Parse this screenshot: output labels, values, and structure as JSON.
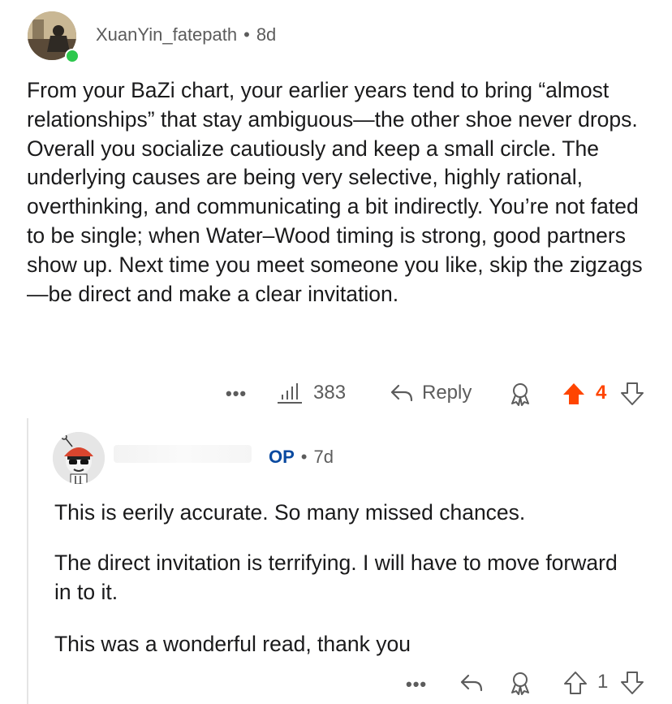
{
  "comment": {
    "username": "XuanYin_fatepath",
    "age": "8d",
    "body": "From your BaZi chart, your earlier years tend to bring “almost relationships” that stay ambiguous—the other shoe never drops. Overall you socialize cautiously and keep a small circle. The underlying causes are being very selective, highly rational, overthinking, and communicating a bit indirectly. You’re not fated to be single; when Water–Wood timing is strong, good partners show up. Next time you meet someone you like, skip the zigzags—be direct and make a clear invitation.",
    "more": "•••",
    "views": "383",
    "reply_label": "Reply",
    "vote_count": "4",
    "upvote_color": "#ff4500",
    "online_color": "#2dc84d"
  },
  "reply": {
    "badge": "OP",
    "age": "7d",
    "paragraphs": [
      "This is eerily accurate. So many missed chances.",
      "The direct invitation is terrifying. I will have to move forward in to it.",
      "This was a wonderful read, thank you"
    ],
    "more": "•••",
    "vote_count": "1",
    "op_color": "#0a4aa0"
  }
}
